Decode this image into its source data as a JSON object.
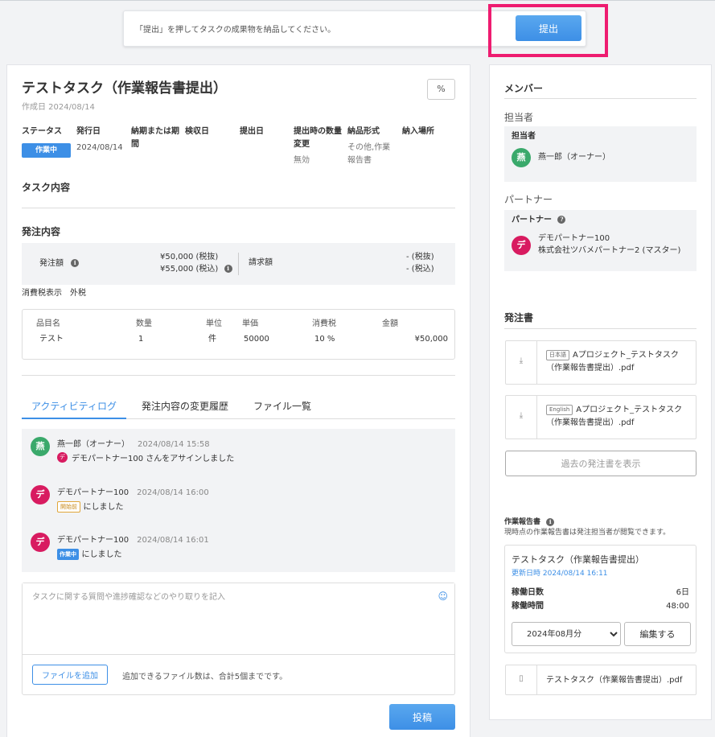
{
  "notice": {
    "text": "「提出」を押してタスクの成果物を納品してください。",
    "submit_label": "提出"
  },
  "task": {
    "title": "テストタスク（作業報告書提出）",
    "created": "作成日 2024/08/14",
    "link_icon": "link-icon",
    "link_glyph": "%"
  },
  "info": {
    "status_label": "ステータス",
    "status_value": "作業中",
    "issue_label": "発行日",
    "issue_value": "2024/08/14",
    "deadline_label_1": "納期または期",
    "deadline_label_2": "間",
    "inspect_label": "検収日",
    "submit_label": "提出日",
    "qty_change_label_1": "提出時の数量",
    "qty_change_label_2": "変更",
    "qty_change_value": "無効",
    "format_label": "納品形式",
    "format_value_1": "その他,作業",
    "format_value_2": "報告書",
    "place_label": "納入場所"
  },
  "sections": {
    "task_content": "タスク内容",
    "order_content": "発注内容"
  },
  "order": {
    "amount_label": "発注額",
    "amount_ex": "¥50,000 (税抜)",
    "amount_in": "¥55,000 (税込)",
    "invoice_label": "請求額",
    "invoice_ex": "- (税抜)",
    "invoice_in": "- (税込)",
    "tax_display": "消費税表示　外税"
  },
  "items": {
    "headers": [
      "品目名",
      "数量",
      "単位",
      "単価",
      "消費税",
      "金額"
    ],
    "rows": [
      [
        "テスト",
        "1",
        "件",
        "50000",
        "10 %",
        "¥50,000"
      ]
    ]
  },
  "tabs": [
    "アクティビティログ",
    "発注内容の変更履歴",
    "ファイル一覧"
  ],
  "activity": [
    {
      "avatar": "燕",
      "name": "燕一郎（オーナー）",
      "time": "2024/08/14 15:58",
      "mini": "デ",
      "msg": "デモパートナー100 さんをアサインしました"
    },
    {
      "avatar": "デ",
      "name": "デモパートナー100",
      "time": "2024/08/14 16:00",
      "badge": "開始前",
      "msg": "にしました"
    },
    {
      "avatar": "デ",
      "name": "デモパートナー100",
      "time": "2024/08/14 16:01",
      "badge": "作業中",
      "msg": "にしました"
    }
  ],
  "compose": {
    "placeholder": "タスクに関する質問や進捗確認などのやり取りを記入",
    "smile_glyph": "☺",
    "file_button": "ファイルを追加",
    "file_note": "追加できるファイル数は、合計5個までです。",
    "post_button": "投稿"
  },
  "members": {
    "title": "メンバー",
    "assignee_section": "担当者",
    "assignee_label": "担当者",
    "assignee_avatar": "燕",
    "assignee_name": "燕一郎（オーナー）",
    "partner_section": "パートナー",
    "partner_label": "パートナー",
    "partner_help": "?",
    "partner_avatar": "デ",
    "partner_name": "デモパートナー100",
    "partner_company": "株式会社ツバメパートナー2 (マスター)"
  },
  "purchase_orders": {
    "title": "発注書",
    "download_glyph": "⤓",
    "files": [
      {
        "lang": "日本語",
        "name_1": "Aプロジェクト_テストタスク",
        "name_2": "（作業報告書提出）.pdf"
      },
      {
        "lang": "English",
        "name_1": "Aプロジェクト_テストタスク",
        "name_2": "（作業報告書提出）.pdf"
      }
    ],
    "past_button": "過去の発注書を表示"
  },
  "work_report": {
    "title": "作業報告書",
    "note": "現時点の作業報告書は発注担当者が閲覧できます。",
    "card_title": "テストタスク（作業報告書提出）",
    "updated": "更新日時 2024/08/14 16:11",
    "days_label": "稼働日数",
    "days_value": "6日",
    "hours_label": "稼働時間",
    "hours_value": "48:00",
    "month": "2024年08月分",
    "edit_button": "編集する",
    "pdf_glyph": "▯",
    "pdf_name": "テストタスク（作業報告書提出）.pdf"
  },
  "colors": {
    "accent": "#3d8fe6",
    "highlight": "#ee1c70",
    "avatar_green": "#3aa96b",
    "avatar_red": "#d81b60"
  }
}
